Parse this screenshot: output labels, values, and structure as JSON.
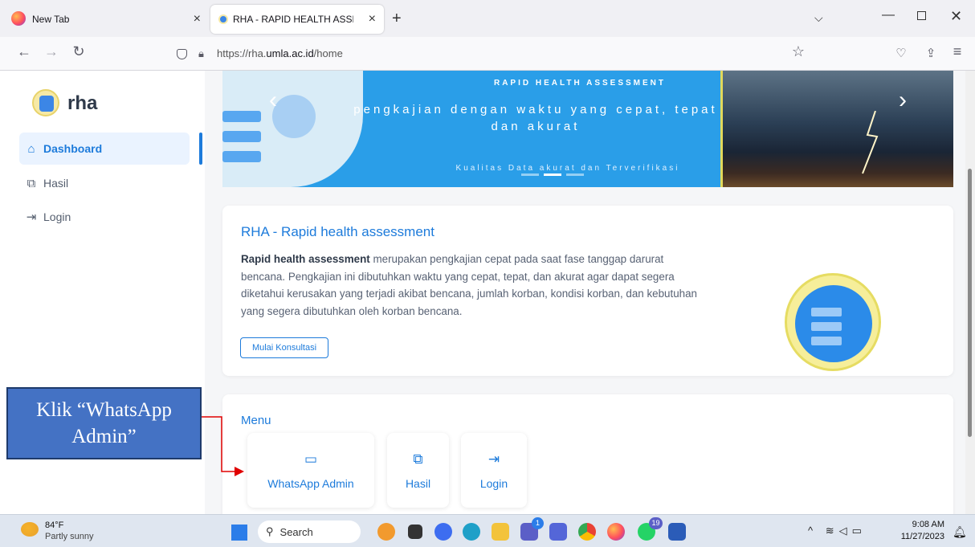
{
  "browser": {
    "tabs": [
      {
        "title": "New Tab",
        "close": "×"
      },
      {
        "title": "RHA - RAPID HEALTH ASSESSM",
        "close": "×"
      }
    ],
    "new_tab": "+",
    "url_prefix": "https://rha.",
    "url_domain": "umla.ac.id",
    "url_path": "/home"
  },
  "sidebar": {
    "brand": "rha",
    "items": [
      {
        "label": "Dashboard",
        "icon": "home-icon"
      },
      {
        "label": "Hasil",
        "icon": "copy-icon"
      },
      {
        "label": "Login",
        "icon": "login-icon"
      }
    ]
  },
  "banner": {
    "tag": "RAPID HEALTH ASSESSMENT",
    "headline": "pengkajian dengan waktu yang cepat, tepat dan akurat",
    "subline": "Kualitas Data akurat dan Terverifikasi",
    "prev": "‹",
    "next": "›"
  },
  "intro_card": {
    "title": "RHA - Rapid health assessment",
    "lead": "Rapid health assessment",
    "body": " merupakan pengkajian cepat pada saat fase tanggap darurat bencana. Pengkajian ini dibutuhkan waktu yang cepat, tepat, dan akurat agar dapat segera diketahui kerusakan yang terjadi akibat bencana, jumlah korban, kondisi korban, dan kebutuhan yang segera dibutuhkan oleh korban bencana.",
    "button": "Mulai Konsultasi"
  },
  "menu": {
    "title": "Menu",
    "items": [
      {
        "label": "WhatsApp Admin",
        "icon": "chat-icon"
      },
      {
        "label": "Hasil",
        "icon": "copy-icon"
      },
      {
        "label": "Login",
        "icon": "login-icon"
      }
    ]
  },
  "annotation": {
    "text": "Klik “WhatsApp Admin”",
    "color": "#4472c4",
    "arrow_color": "#e00000"
  },
  "taskbar": {
    "temp": "84°F",
    "weather": "Partly sunny",
    "search": "Search",
    "time": "9:08 AM",
    "date": "11/27/2023",
    "badge_teams": "1",
    "badge_whatsapp": "19"
  },
  "colors": {
    "accent": "#1d7bdb",
    "banner": "#2a9ee8"
  }
}
